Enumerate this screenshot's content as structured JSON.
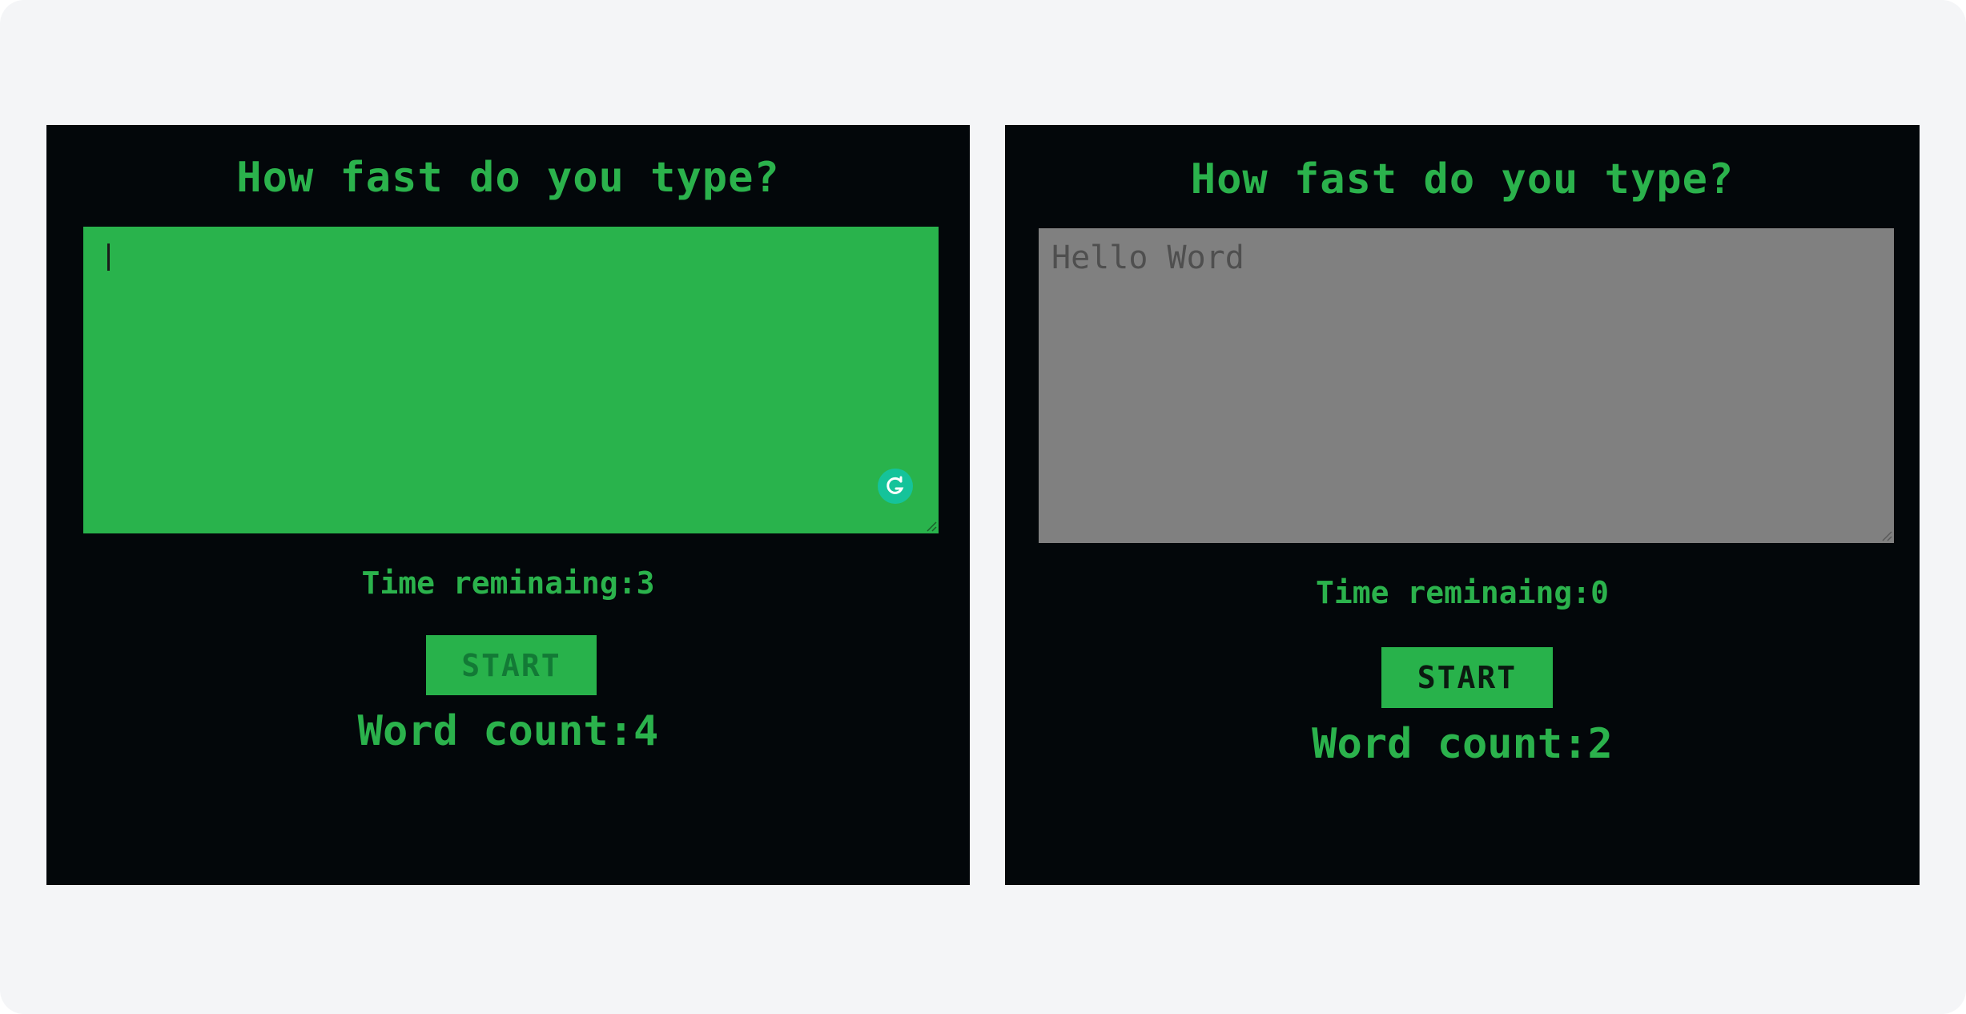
{
  "left_panel": {
    "title": "How fast do you type?",
    "textarea_value": "",
    "timer_text": "Time reminaing:3",
    "start_label": "START",
    "word_count_text": "Word count:4",
    "textarea_color": "#29b34c",
    "extension_icon": "grammarly-icon"
  },
  "right_panel": {
    "title": "How fast do you type?",
    "textarea_value": "Hello Word",
    "timer_text": "Time reminaing:0",
    "start_label": "START",
    "word_count_text": "Word count:2",
    "textarea_color": "#808080"
  },
  "colors": {
    "background": "#03070a",
    "accent": "#2bb24c"
  }
}
